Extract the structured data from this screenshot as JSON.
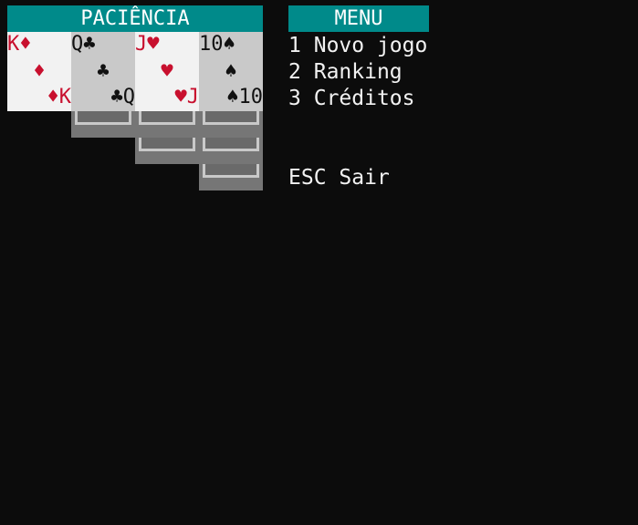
{
  "title": "PACIÊNCIA",
  "menu": {
    "title": "MENU",
    "items": [
      {
        "key": "1",
        "label": "Novo jogo"
      },
      {
        "key": "2",
        "label": "Ranking"
      },
      {
        "key": "3",
        "label": "Créditos"
      }
    ],
    "exit": {
      "key": "ESC",
      "label": "Sair"
    }
  },
  "colors": {
    "background": "#0c0c0c",
    "header": "#008a8a",
    "red_suit": "#c8102e",
    "black_suit": "#111111",
    "card_light": "#f2f2f2",
    "card_gray": "#c9c9c9",
    "face_down": "#767676"
  },
  "columns": [
    {
      "hidden_cards": 0,
      "top_card": {
        "rank": "K",
        "suit": "♦",
        "color": "red"
      }
    },
    {
      "hidden_cards": 1,
      "top_card": {
        "rank": "Q",
        "suit": "♣",
        "color": "black"
      }
    },
    {
      "hidden_cards": 2,
      "top_card": {
        "rank": "J",
        "suit": "♥",
        "color": "red"
      }
    },
    {
      "hidden_cards": 3,
      "top_card": {
        "rank": "10",
        "suit": "♠",
        "color": "black"
      }
    }
  ]
}
